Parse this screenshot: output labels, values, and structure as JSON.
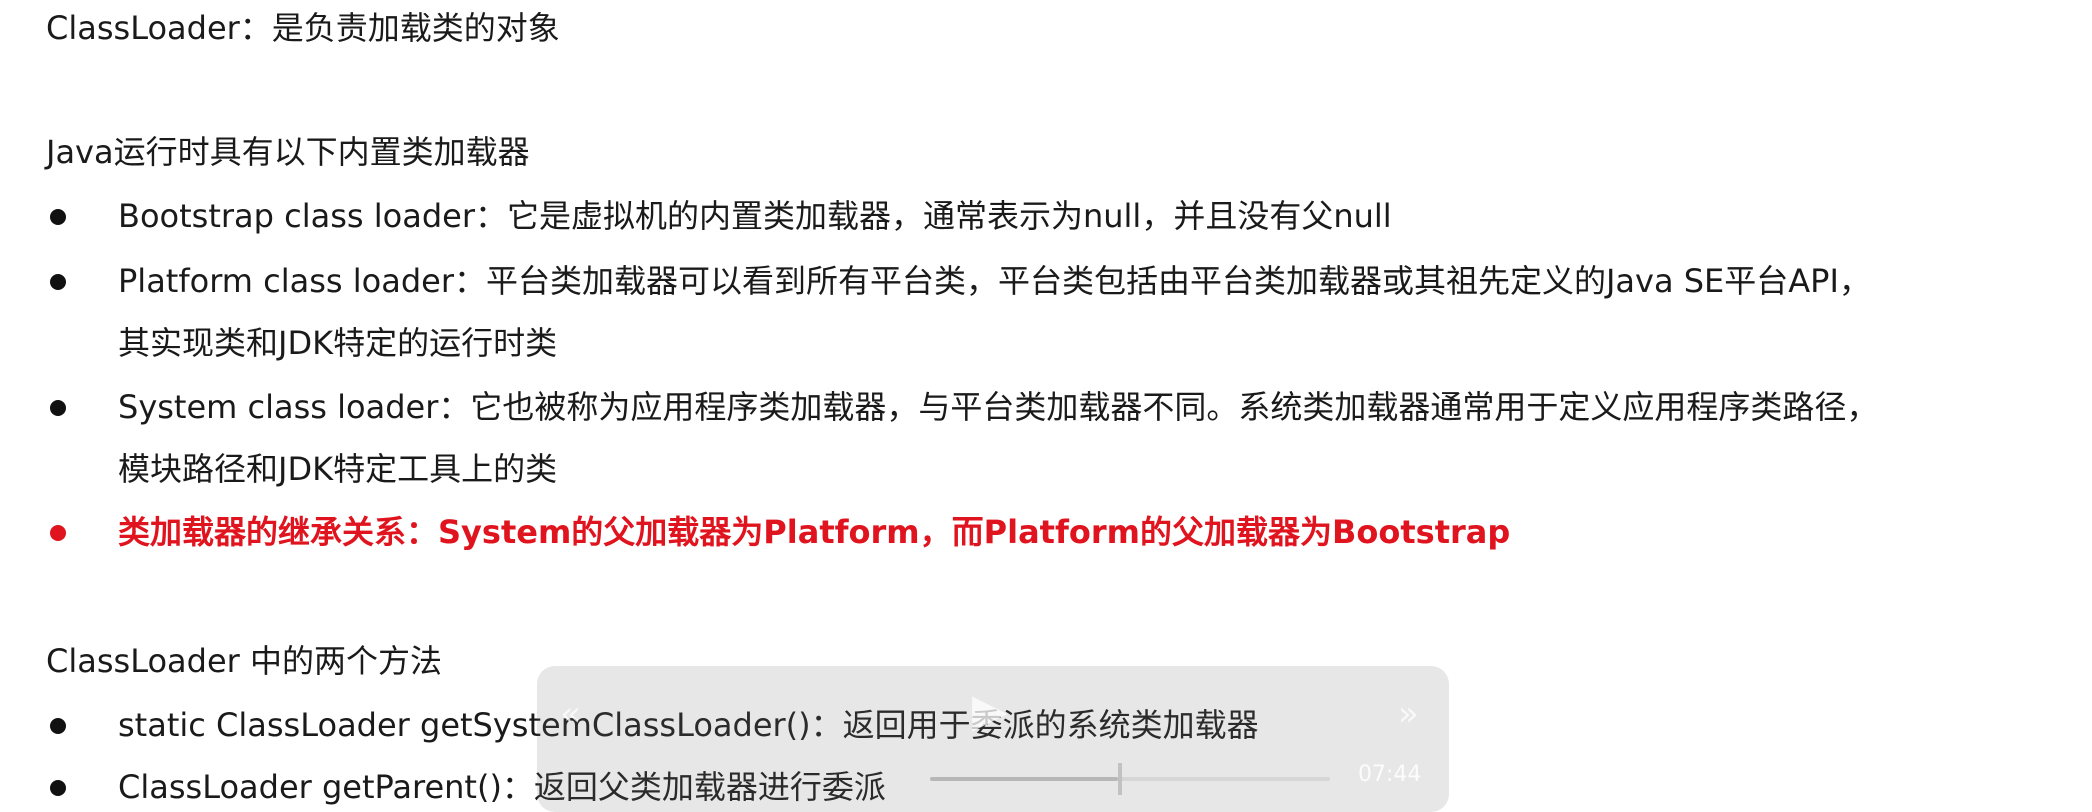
{
  "slide": {
    "heading1": "ClassLoader：是负责加载类的对象",
    "heading2": "Java运行时具有以下内置类加载器",
    "builtins": [
      "Bootstrap class loader：它是虚拟机的内置类加载器，通常表示为null，并且没有父null",
      "Platform class loader：平台类加载器可以看到所有平台类，平台类包括由平台类加载器或其祖先定义的Java SE平台API，",
      "其实现类和JDK特定的运行时类",
      "System class loader：它也被称为应用程序类加载器，与平台类加载器不同。系统类加载器通常用于定义应用程序类路径，",
      "模块路径和JDK特定工具上的类"
    ],
    "highlight": "类加载器的继承关系：System的父加载器为Platform，而Platform的父加载器为Bootstrap",
    "heading3": "ClassLoader 中的两个方法",
    "methods": [
      "static ClassLoader getSystemClassLoader()：返回用于委派的系统类加载器",
      "ClassLoader getParent()：返回父类加载器进行委派"
    ]
  },
  "player": {
    "rewind_icon": "«",
    "play_icon": "▶",
    "forward_icon": "»",
    "time": "07:44",
    "progress": 0.47
  },
  "colors": {
    "highlight": "#e0141e",
    "text": "#1a1a1a"
  }
}
